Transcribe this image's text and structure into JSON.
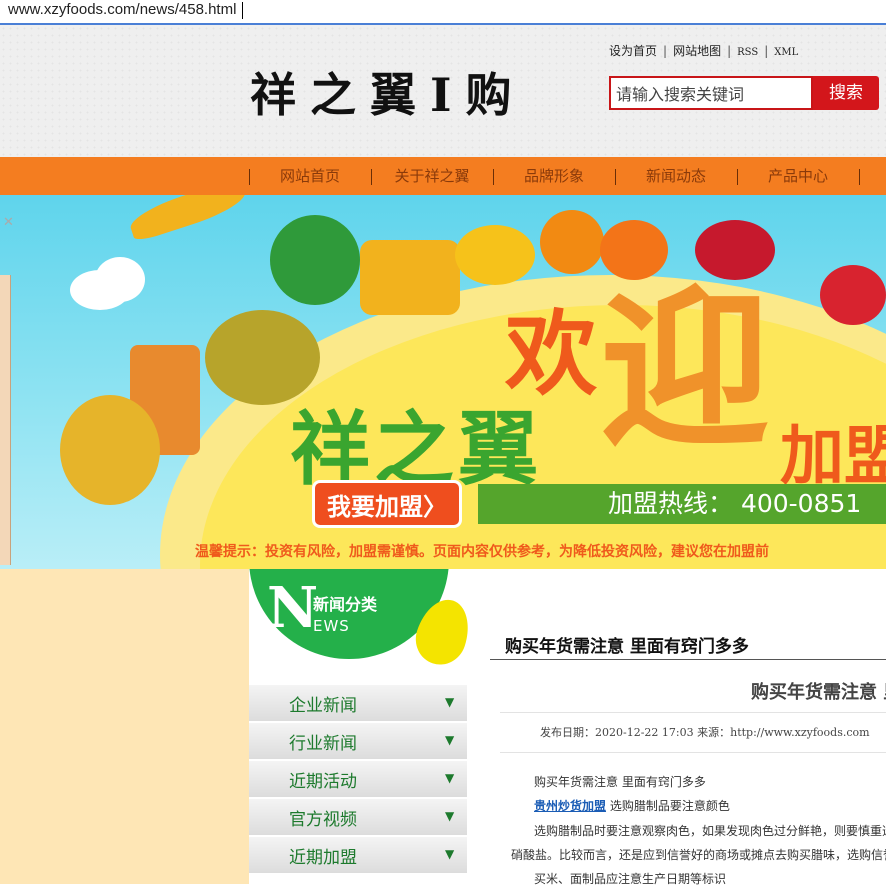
{
  "browser": {
    "url": "www.xzyfoods.com/news/458.html"
  },
  "header": {
    "logo": "祥之翼I购",
    "toplinks": [
      "设为首页",
      "网站地图",
      "RSS",
      "XML"
    ],
    "search": {
      "placeholder": "请输入搜索关键词",
      "button": "搜索"
    }
  },
  "nav": {
    "items": [
      "网站首页",
      "关于祥之翼",
      "品牌形象",
      "新闻动态",
      "产品中心"
    ]
  },
  "banner": {
    "welcome_part1": "欢",
    "welcome_part2": "迎",
    "brand": "祥之翼",
    "join_word": "加盟",
    "join_button": "我要加盟〉",
    "hotline": "加盟热线：  400-0851",
    "tip": "温馨提示：投资有风险，加盟需谨慎。页面内容仅供参考，为降低投资风险，建议您在加盟前"
  },
  "sidebar": {
    "badge": {
      "letter": "N",
      "title": "新闻分类",
      "sub": "EWS"
    },
    "categories": [
      "企业新闻",
      "行业新闻",
      "近期活动",
      "官方视频",
      "近期加盟"
    ]
  },
  "article": {
    "section_title": "购买年货需注意 里面有窍门多多",
    "title": "购买年货需注意 里",
    "meta": "发布日期：2020-12-22 17:03   来源：http://www.xzyfoods.com",
    "para1": "购买年货需注意 里面有窍门多多",
    "link_text": "贵州炒货加盟",
    "para2_rest": " 选购腊制品要注意颜色",
    "para3": "选购腊制品时要注意观察肉色，如果发现肉色过分鲜艳，则要慎重选",
    "para4": "硝酸盐。比较而言，还是应到信誉好的商场或摊点去购买腊味，选购信誉",
    "para5": "买米、面制品应注意生产日期等标识"
  },
  "colors": {
    "nav": "#f47d20",
    "search_border": "#c81518",
    "green": "#24b04a",
    "side_panel": "#fee6b5"
  }
}
